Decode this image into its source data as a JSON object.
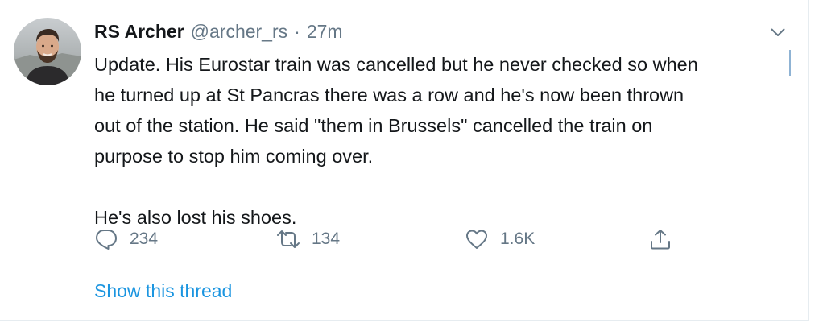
{
  "tweet": {
    "author_name": "RS Archer",
    "handle": "@archer_rs",
    "separator": "·",
    "time": "27m",
    "lines": [
      "Update.  His Eurostar train was cancelled but he never checked so when",
      "he turned up at St Pancras there was a row and he's now been thrown",
      "out of the station.  He said \"them in Brussels\" cancelled the train on",
      "purpose to stop him coming over.",
      "",
      "He's also lost his shoes."
    ],
    "reply_count": "234",
    "retweet_count": "134",
    "like_count": "1.6K",
    "show_thread_label": "Show this thread"
  },
  "icons": {
    "avatar": "avatar",
    "caret": "chevron-down-icon",
    "reply": "reply-icon",
    "retweet": "retweet-icon",
    "like": "heart-icon",
    "share": "share-icon"
  },
  "colors": {
    "text": "#14171a",
    "secondary": "#657786",
    "link": "#1b95e0",
    "border": "#e6ecf0"
  }
}
